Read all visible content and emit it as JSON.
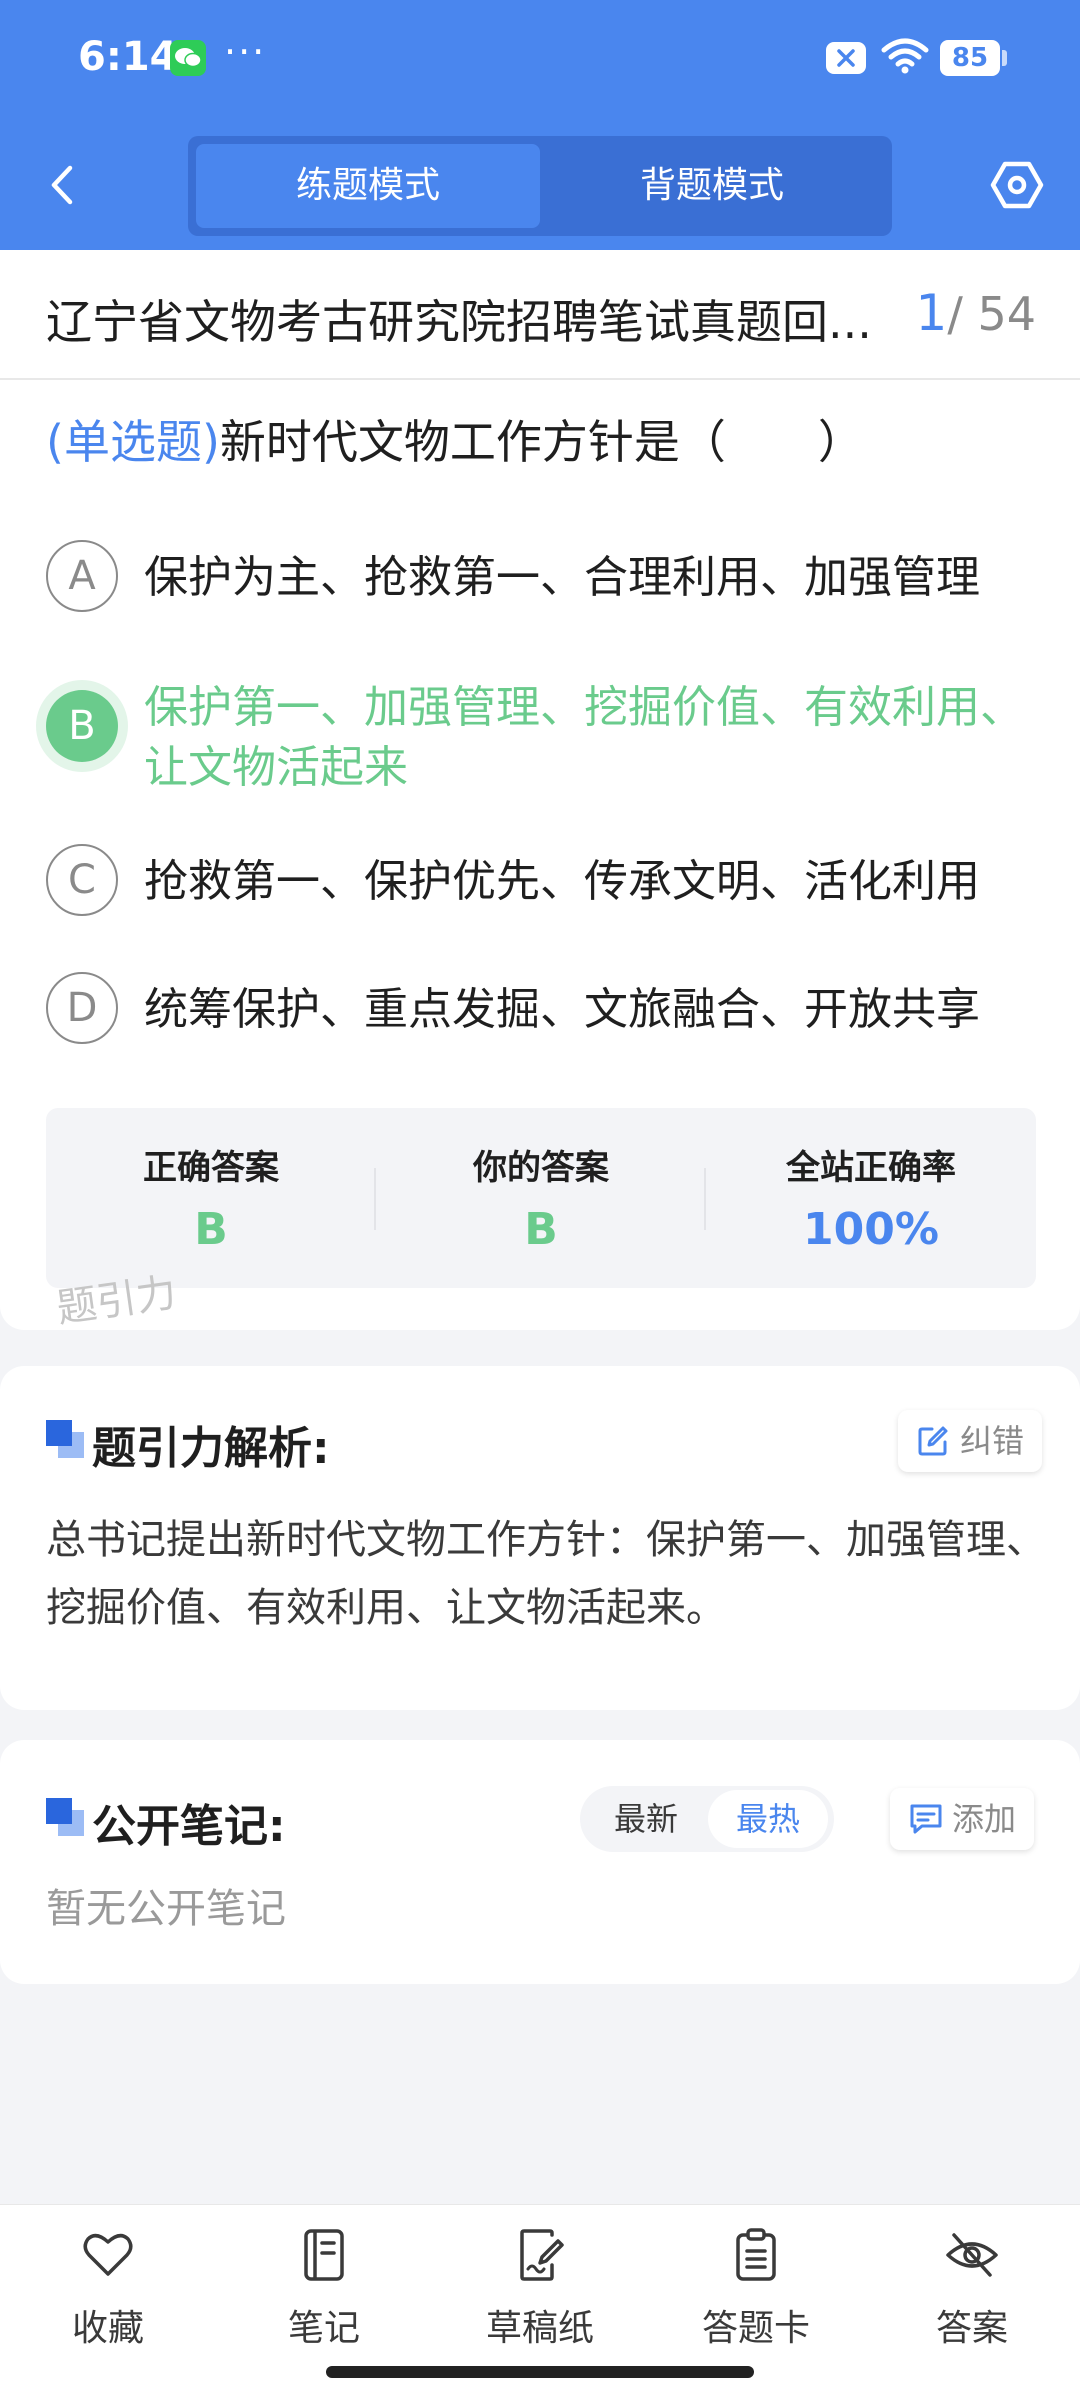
{
  "status_bar": {
    "time": "6:14",
    "dots": "···",
    "battery": "85"
  },
  "header": {
    "modes": [
      "练题模式",
      "背题模式"
    ],
    "active_mode": "练题模式"
  },
  "paper": {
    "title": "辽宁省文物考古研究院招聘笔试真题回...",
    "current": "1",
    "total": "/ 54"
  },
  "question": {
    "type": "(单选题)",
    "stem": "新时代文物工作方针是（　　）",
    "options": [
      {
        "letter": "A",
        "text": "保护为主、抢救第一、合理利用、加强管理",
        "correct": false
      },
      {
        "letter": "B",
        "text": "保护第一、加强管理、挖掘价值、有效利用、让文物活起来",
        "correct": true
      },
      {
        "letter": "C",
        "text": "抢救第一、保护优先、传承文明、活化利用",
        "correct": false
      },
      {
        "letter": "D",
        "text": "统筹保护、重点发掘、文旅融合、开放共享",
        "correct": false
      }
    ]
  },
  "answer_summary": {
    "correct_label": "正确答案",
    "correct_value": "B",
    "yours_label": "你的答案",
    "yours_value": "B",
    "rate_label": "全站正确率",
    "rate_value": "100%"
  },
  "watermark": "题引力",
  "analysis": {
    "title": "题引力解析:",
    "error_button": "纠错",
    "text": "总书记提出新时代文物工作方针：保护第一、加强管理、挖掘价值、有效利用、让文物活起来。"
  },
  "notes": {
    "title": "公开笔记:",
    "sort_latest": "最新",
    "sort_hot": "最热",
    "add_button": "添加",
    "empty": "暂无公开笔记"
  },
  "bottom_nav": [
    {
      "label": "收藏",
      "icon": "heart-icon"
    },
    {
      "label": "笔记",
      "icon": "notebook-icon"
    },
    {
      "label": "草稿纸",
      "icon": "draft-icon"
    },
    {
      "label": "答题卡",
      "icon": "answer-card-icon"
    },
    {
      "label": "答案",
      "icon": "eye-off-icon"
    }
  ],
  "colors": {
    "primary": "#4a86ee",
    "correct": "#6acb8c"
  }
}
